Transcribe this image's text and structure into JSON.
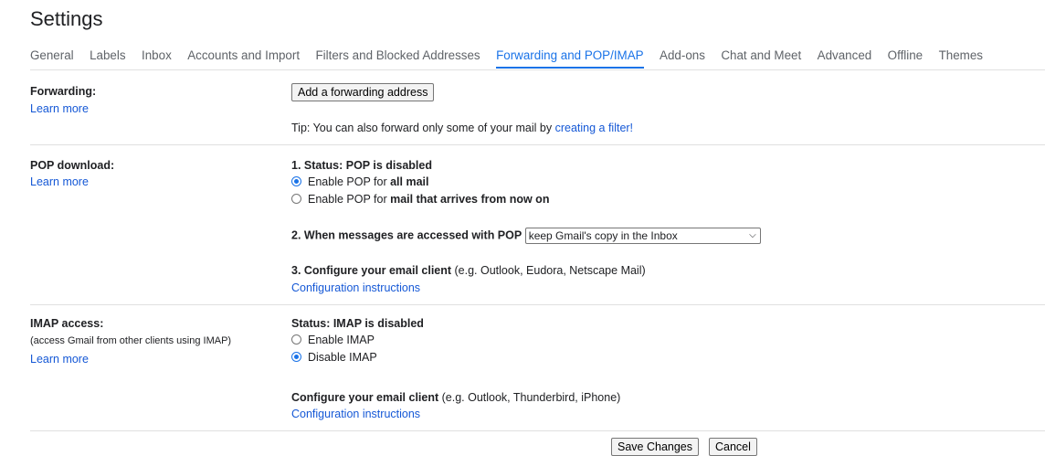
{
  "page": {
    "title": "Settings"
  },
  "tabs": [
    {
      "label": "General"
    },
    {
      "label": "Labels"
    },
    {
      "label": "Inbox"
    },
    {
      "label": "Accounts and Import"
    },
    {
      "label": "Filters and Blocked Addresses"
    },
    {
      "label": "Forwarding and POP/IMAP",
      "active": true
    },
    {
      "label": "Add-ons"
    },
    {
      "label": "Chat and Meet"
    },
    {
      "label": "Advanced"
    },
    {
      "label": "Offline"
    },
    {
      "label": "Themes"
    }
  ],
  "forwarding": {
    "label": "Forwarding:",
    "learn_more": "Learn more",
    "add_button": "Add a forwarding address",
    "tip_text": "Tip: You can also forward only some of your mail by ",
    "tip_link": "creating a filter!"
  },
  "pop": {
    "label": "POP download:",
    "learn_more": "Learn more",
    "status": "1. Status: POP is disabled",
    "opt1_prefix": "Enable POP for ",
    "opt1_bold": "all mail",
    "opt2_prefix": "Enable POP for ",
    "opt2_bold": "mail that arrives from now on",
    "access_label": "2. When messages are accessed with POP",
    "access_select": "keep Gmail's copy in the Inbox",
    "configure_bold": "3. Configure your email client",
    "configure_rest": " (e.g. Outlook, Eudora, Netscape Mail)",
    "config_link": "Configuration instructions"
  },
  "imap": {
    "label": "IMAP access:",
    "sub": "(access Gmail from other clients using IMAP)",
    "learn_more": "Learn more",
    "status": "Status: IMAP is disabled",
    "enable": "Enable IMAP",
    "disable": "Disable IMAP",
    "configure_bold": "Configure your email client",
    "configure_rest": " (e.g. Outlook, Thunderbird, iPhone)",
    "config_link": "Configuration instructions"
  },
  "footer": {
    "save": "Save Changes",
    "cancel": "Cancel"
  },
  "colors": {
    "accent": "#1a73e8",
    "link": "#1558d6"
  }
}
